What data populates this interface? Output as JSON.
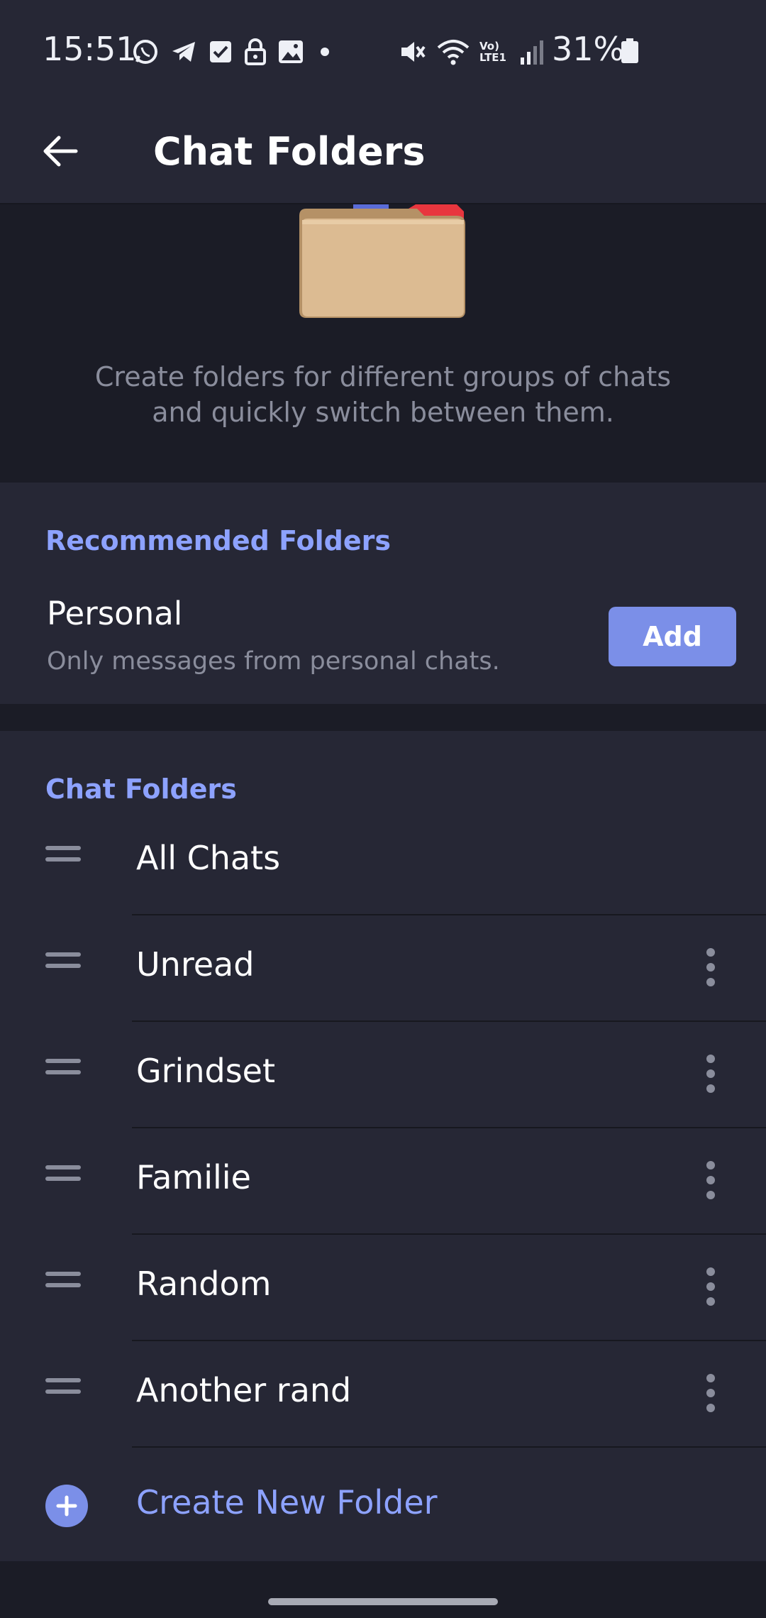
{
  "status_bar": {
    "time": "15:51",
    "battery_text": "31%",
    "left_icons": [
      "whatsapp-icon",
      "telegram-icon",
      "checkbox-icon",
      "lock-icon",
      "image-icon",
      "dot-icon"
    ],
    "right_icons": [
      "mute-icon",
      "wifi-icon",
      "volte-icon",
      "signal-icon",
      "battery-icon"
    ],
    "volte_text": "Vo) LTE1"
  },
  "appbar": {
    "title": "Chat Folders",
    "back_icon": "arrow-left-icon"
  },
  "hero": {
    "description": "Create folders for different groups of chats and quickly switch between them."
  },
  "recommended": {
    "header": "Recommended Folders",
    "items": [
      {
        "title": "Personal",
        "subtitle": "Only messages from personal chats.",
        "button": "Add"
      }
    ]
  },
  "folders": {
    "header": "Chat Folders",
    "items": [
      {
        "label": "All Chats",
        "has_menu": false
      },
      {
        "label": "Unread",
        "has_menu": true
      },
      {
        "label": "Grindset",
        "has_menu": true
      },
      {
        "label": "Familie",
        "has_menu": true
      },
      {
        "label": "Random",
        "has_menu": true
      },
      {
        "label": "Another rand",
        "has_menu": true
      }
    ],
    "create_label": "Create New Folder"
  },
  "colors": {
    "accent": "#8da2ff",
    "button": "#7b8fe8",
    "surface": "#262735",
    "background": "#1b1c26",
    "secondary_text": "#8a8d9c"
  }
}
